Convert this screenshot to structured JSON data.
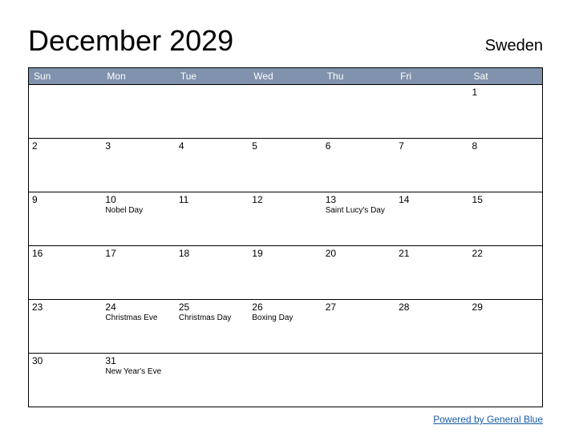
{
  "header": {
    "title": "December 2029",
    "region": "Sweden"
  },
  "days": [
    "Sun",
    "Mon",
    "Tue",
    "Wed",
    "Thu",
    "Fri",
    "Sat"
  ],
  "weeks": [
    [
      {
        "num": "",
        "event": ""
      },
      {
        "num": "",
        "event": ""
      },
      {
        "num": "",
        "event": ""
      },
      {
        "num": "",
        "event": ""
      },
      {
        "num": "",
        "event": ""
      },
      {
        "num": "",
        "event": ""
      },
      {
        "num": "1",
        "event": ""
      }
    ],
    [
      {
        "num": "2",
        "event": ""
      },
      {
        "num": "3",
        "event": ""
      },
      {
        "num": "4",
        "event": ""
      },
      {
        "num": "5",
        "event": ""
      },
      {
        "num": "6",
        "event": ""
      },
      {
        "num": "7",
        "event": ""
      },
      {
        "num": "8",
        "event": ""
      }
    ],
    [
      {
        "num": "9",
        "event": ""
      },
      {
        "num": "10",
        "event": "Nobel Day"
      },
      {
        "num": "11",
        "event": ""
      },
      {
        "num": "12",
        "event": ""
      },
      {
        "num": "13",
        "event": "Saint Lucy's Day"
      },
      {
        "num": "14",
        "event": ""
      },
      {
        "num": "15",
        "event": ""
      }
    ],
    [
      {
        "num": "16",
        "event": ""
      },
      {
        "num": "17",
        "event": ""
      },
      {
        "num": "18",
        "event": ""
      },
      {
        "num": "19",
        "event": ""
      },
      {
        "num": "20",
        "event": ""
      },
      {
        "num": "21",
        "event": ""
      },
      {
        "num": "22",
        "event": ""
      }
    ],
    [
      {
        "num": "23",
        "event": ""
      },
      {
        "num": "24",
        "event": "Christmas Eve"
      },
      {
        "num": "25",
        "event": "Christmas Day"
      },
      {
        "num": "26",
        "event": "Boxing Day"
      },
      {
        "num": "27",
        "event": ""
      },
      {
        "num": "28",
        "event": ""
      },
      {
        "num": "29",
        "event": ""
      }
    ],
    [
      {
        "num": "30",
        "event": ""
      },
      {
        "num": "31",
        "event": "New Year's Eve"
      },
      {
        "num": "",
        "event": ""
      },
      {
        "num": "",
        "event": ""
      },
      {
        "num": "",
        "event": ""
      },
      {
        "num": "",
        "event": ""
      },
      {
        "num": "",
        "event": ""
      }
    ]
  ],
  "footer": {
    "link_text": "Powered by General Blue"
  }
}
